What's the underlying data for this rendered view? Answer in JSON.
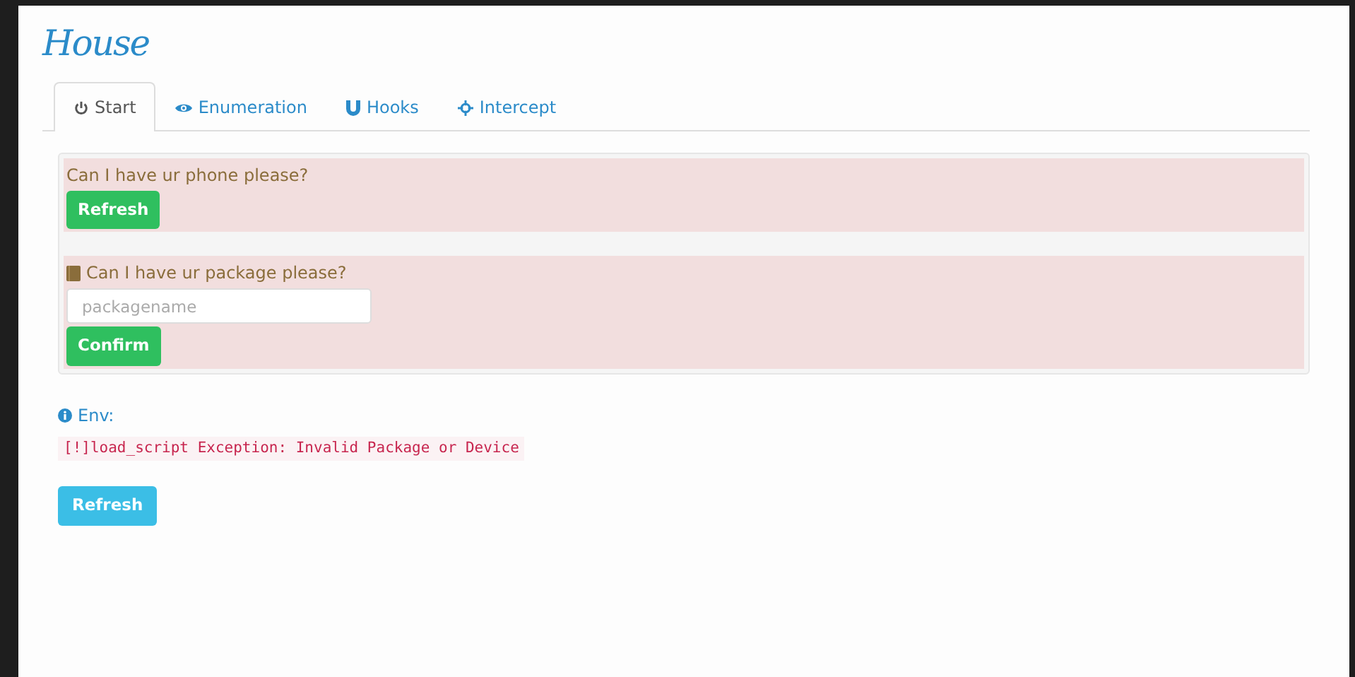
{
  "title": "House",
  "tabs": [
    {
      "label": "Start",
      "kind": "power",
      "selected": true
    },
    {
      "label": "Enumeration",
      "kind": "eye",
      "selected": false
    },
    {
      "label": "Hooks",
      "kind": "magnet",
      "selected": false
    },
    {
      "label": "Intercept",
      "kind": "crosshair",
      "selected": false
    }
  ],
  "panels": [
    {
      "kind": "button",
      "question": "Can I have ur phone please?",
      "button": "Refresh"
    },
    {
      "kind": "form",
      "question": "Can I have ur package please?",
      "placeholder": "packagename",
      "button": "Confirm"
    }
  ],
  "env": {
    "label": "Env:",
    "message": "[!]load_script Exception: Invalid Package or Device"
  },
  "refresh_button": "Refresh"
}
